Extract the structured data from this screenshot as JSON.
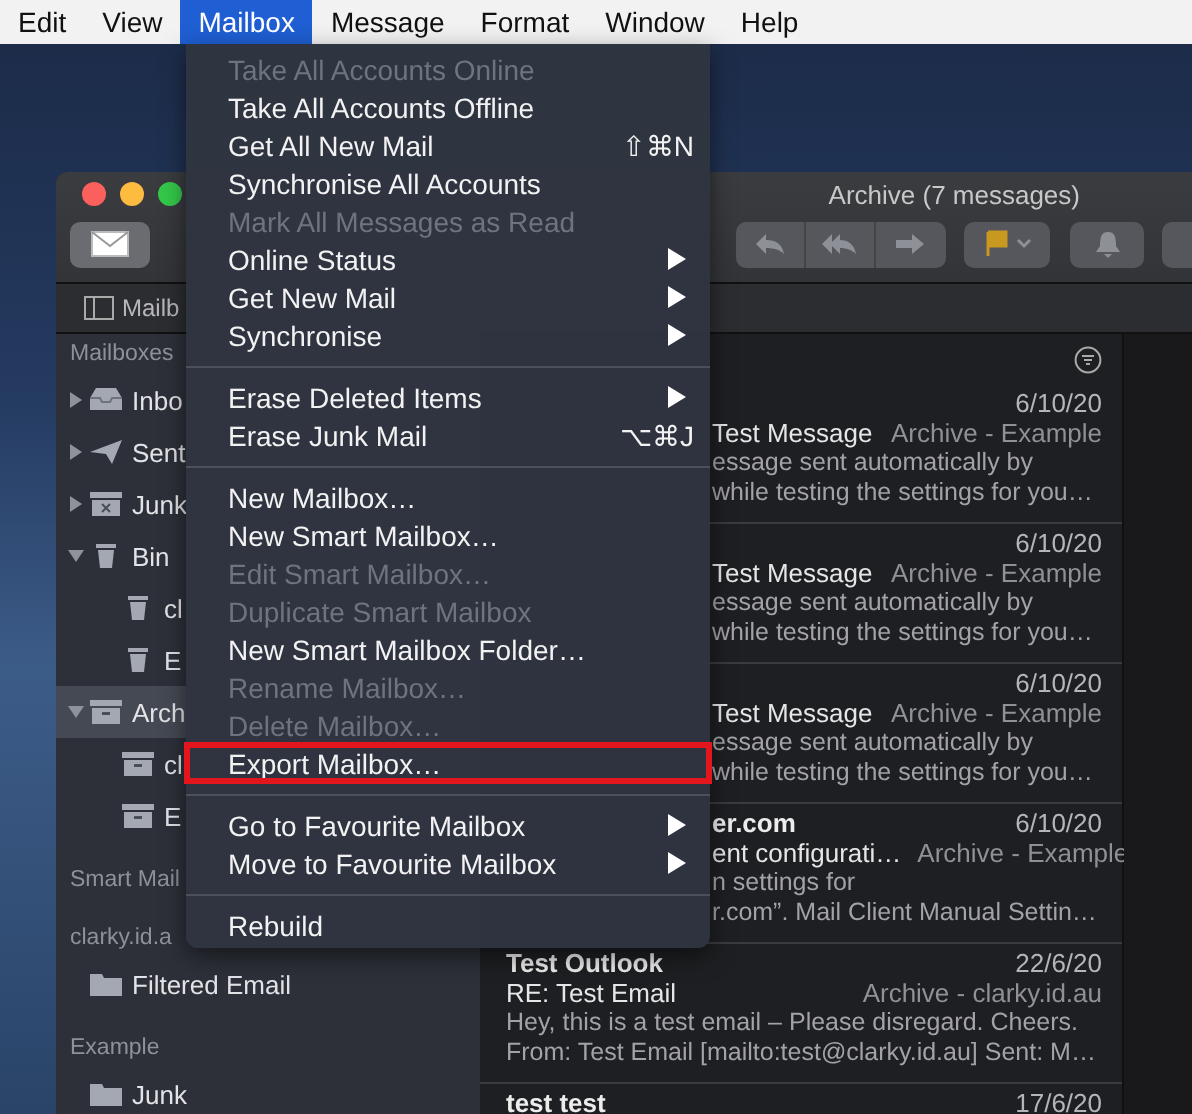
{
  "menubar": [
    {
      "label": "Edit",
      "selected": false
    },
    {
      "label": "View",
      "selected": false
    },
    {
      "label": "Mailbox",
      "selected": true
    },
    {
      "label": "Message",
      "selected": false
    },
    {
      "label": "Format",
      "selected": false
    },
    {
      "label": "Window",
      "selected": false
    },
    {
      "label": "Help",
      "selected": false
    }
  ],
  "window": {
    "title": "Archive (7 messages)",
    "favourites_button": "Mailb"
  },
  "sidebar": {
    "sections": [
      {
        "title": "Mailboxes",
        "items": [
          {
            "label": "Inbo",
            "kind": "inbox",
            "expanded": false,
            "selected": false
          },
          {
            "label": "Sent",
            "kind": "sent",
            "expanded": false,
            "selected": false
          },
          {
            "label": "Junk",
            "kind": "junk",
            "expanded": false,
            "selected": false
          },
          {
            "label": "Bin",
            "kind": "trash",
            "expanded": true,
            "selected": false,
            "children": [
              {
                "label": "cl",
                "kind": "trash",
                "selected": false
              },
              {
                "label": "E",
                "kind": "trash",
                "selected": false
              }
            ]
          },
          {
            "label": "Arch",
            "kind": "archive",
            "expanded": true,
            "selected": true,
            "children": [
              {
                "label": "cl",
                "kind": "archive",
                "selected": false
              },
              {
                "label": "E",
                "kind": "archive",
                "selected": false
              }
            ]
          }
        ]
      },
      {
        "title": "Smart Mail"
      },
      {
        "title": "clarky.id.a",
        "items": [
          {
            "label": "Filtered Email",
            "kind": "folder",
            "selected": false
          }
        ]
      },
      {
        "title": "Example",
        "items": [
          {
            "label": "Junk",
            "kind": "folder",
            "selected": false
          }
        ]
      }
    ]
  },
  "messages": [
    {
      "kind": "clipped",
      "date": "6/10/20",
      "subject": "Test Message",
      "mailbox": "Archive - Example",
      "preview": [
        "essage sent automatically by",
        "while testing the settings for you…"
      ]
    },
    {
      "kind": "clipped",
      "date": "6/10/20",
      "subject": "Test Message",
      "mailbox": "Archive - Example",
      "preview": [
        "essage sent automatically by",
        "while testing the settings for you…"
      ]
    },
    {
      "kind": "clipped",
      "date": "6/10/20",
      "subject": "Test Message",
      "mailbox": "Archive - Example",
      "preview": [
        "essage sent automatically by",
        "while testing the settings for you…"
      ]
    },
    {
      "kind": "clipped",
      "sender": "er.com",
      "date": "6/10/20",
      "subject": "ent configurati…",
      "mailbox": "Archive - Example",
      "preview": [
        "n settings for",
        "r.com”. Mail Client Manual Settin…"
      ]
    },
    {
      "kind": "full",
      "sender": "Test Outlook",
      "date": "22/6/20",
      "subject": "RE: Test Email",
      "mailbox": "Archive - clarky.id.au",
      "preview": [
        "Hey, this is a test email – Please disregard. Cheers.",
        "From: Test Email [mailto:test@clarky.id.au] Sent: M…"
      ]
    },
    {
      "kind": "full",
      "sender": "test test",
      "date": "17/6/20"
    }
  ],
  "menu": {
    "items": [
      {
        "kind": "item",
        "label": "Take All Accounts Online",
        "disabled": true
      },
      {
        "kind": "item",
        "label": "Take All Accounts Offline",
        "disabled": false
      },
      {
        "kind": "item",
        "label": "Get All New Mail",
        "shortcut": "⇧⌘N",
        "disabled": false
      },
      {
        "kind": "item",
        "label": "Synchronise All Accounts",
        "disabled": false
      },
      {
        "kind": "item",
        "label": "Mark All Messages as Read",
        "disabled": true
      },
      {
        "kind": "item",
        "label": "Online Status",
        "submenu": true,
        "disabled": false
      },
      {
        "kind": "item",
        "label": "Get New Mail",
        "submenu": true,
        "disabled": false
      },
      {
        "kind": "item",
        "label": "Synchronise",
        "submenu": true,
        "disabled": false
      },
      {
        "kind": "separator"
      },
      {
        "kind": "item",
        "label": "Erase Deleted Items",
        "submenu": true,
        "disabled": false
      },
      {
        "kind": "item",
        "label": "Erase Junk Mail",
        "shortcut": "⌥⌘J",
        "disabled": false
      },
      {
        "kind": "separator"
      },
      {
        "kind": "item",
        "label": "New Mailbox…",
        "disabled": false
      },
      {
        "kind": "item",
        "label": "New Smart Mailbox…",
        "disabled": false
      },
      {
        "kind": "item",
        "label": "Edit Smart Mailbox…",
        "disabled": true
      },
      {
        "kind": "item",
        "label": "Duplicate Smart Mailbox",
        "disabled": true
      },
      {
        "kind": "item",
        "label": "New Smart Mailbox Folder…",
        "disabled": false
      },
      {
        "kind": "item",
        "label": "Rename Mailbox…",
        "disabled": true
      },
      {
        "kind": "item",
        "label": "Delete Mailbox…",
        "disabled": true
      },
      {
        "kind": "item",
        "label": "Export Mailbox…",
        "disabled": false,
        "highlighted": true
      },
      {
        "kind": "separator"
      },
      {
        "kind": "item",
        "label": "Go to Favourite Mailbox",
        "submenu": true,
        "disabled": false
      },
      {
        "kind": "item",
        "label": "Move to Favourite Mailbox",
        "submenu": true,
        "disabled": false
      },
      {
        "kind": "separator"
      },
      {
        "kind": "item",
        "label": "Rebuild",
        "disabled": false
      }
    ]
  }
}
